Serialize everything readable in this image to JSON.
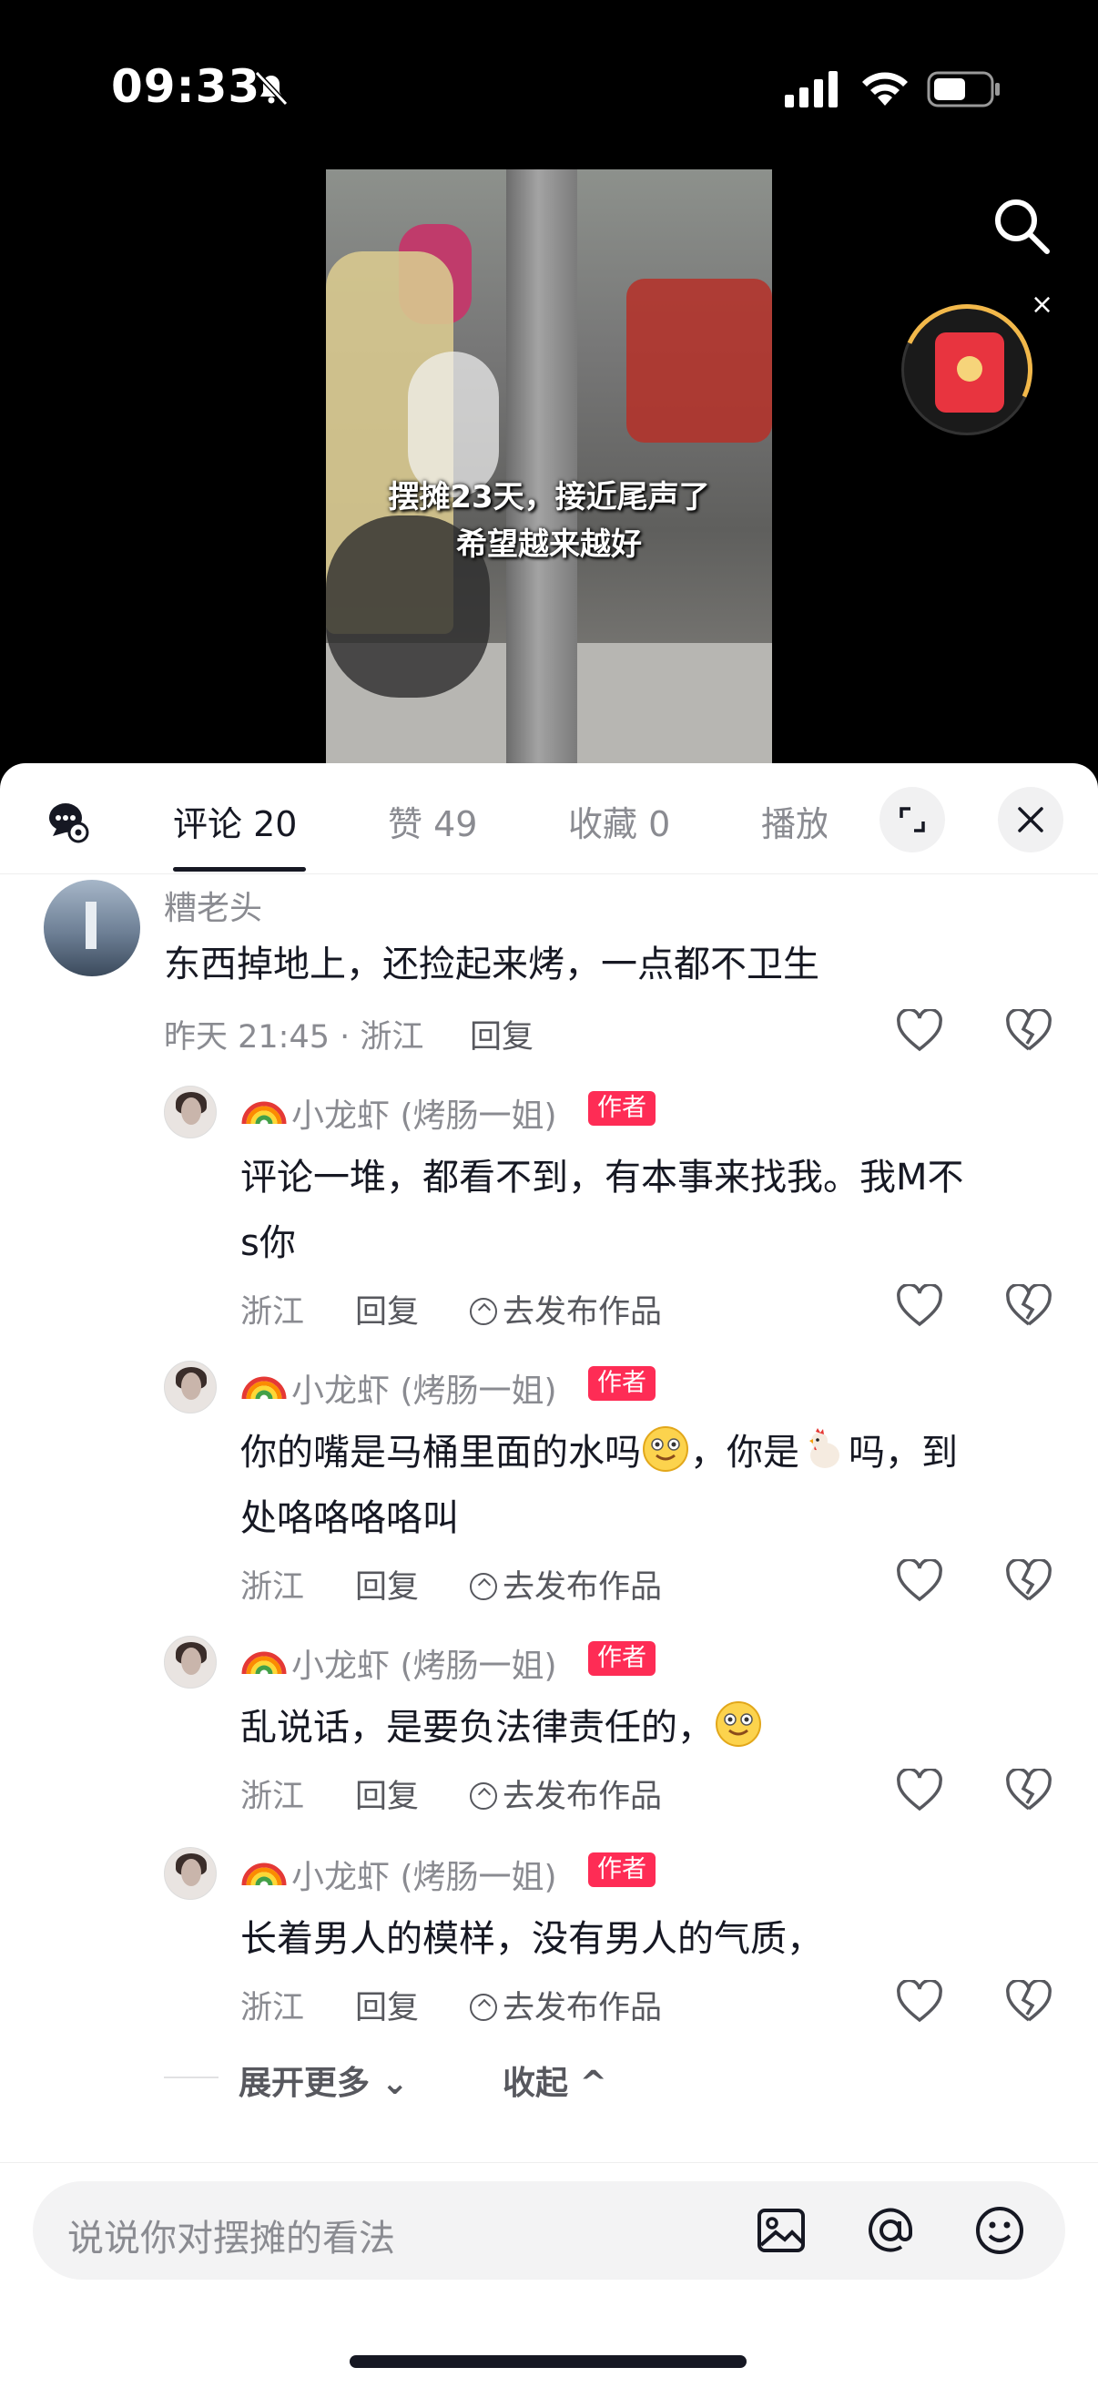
{
  "status": {
    "time": "09:33"
  },
  "video": {
    "caption_line1": "摆摊23天，接近尾声了",
    "caption_line2": "希望越来越好"
  },
  "tabs": [
    {
      "label": "评论 20"
    },
    {
      "label": "赞 49"
    },
    {
      "label": "收藏 0"
    },
    {
      "label": "播放"
    }
  ],
  "comment": {
    "user": "糟老头",
    "text": "东西掉地上，还捡起来烤，一点都不卫生",
    "time_location": "昨天 21:45 · 浙江",
    "reply_label": "回复"
  },
  "replies": [
    {
      "user": "小龙虾 (烤肠一姐)",
      "badge": "作者",
      "line1": "评论一堆，都看不到，有本事来找我。我M不",
      "line2": "s你",
      "location": "浙江",
      "reply_label": "回复",
      "publish_label": "去发布作品"
    },
    {
      "user": "小龙虾 (烤肠一姐)",
      "badge": "作者",
      "line1a": "你的嘴是马桶里面的水吗",
      "line1b": "，你是",
      "line1c": "吗，到",
      "line2": "处咯咯咯咯叫",
      "location": "浙江",
      "reply_label": "回复",
      "publish_label": "去发布作品"
    },
    {
      "user": "小龙虾 (烤肠一姐)",
      "badge": "作者",
      "line1": "乱说话，是要负法律责任的，",
      "location": "浙江",
      "reply_label": "回复",
      "publish_label": "去发布作品"
    },
    {
      "user": "小龙虾 (烤肠一姐)",
      "badge": "作者",
      "line1": "长着男人的模样，没有男人的气质，",
      "location": "浙江",
      "reply_label": "回复",
      "publish_label": "去发布作品"
    }
  ],
  "thread": {
    "expand_label": "展开更多",
    "collapse_label": "收起"
  },
  "input": {
    "placeholder": "说说你对摆摊的看法"
  },
  "colors": {
    "accent": "#fe2c55",
    "text": "#161823",
    "muted": "#8a8b91"
  }
}
